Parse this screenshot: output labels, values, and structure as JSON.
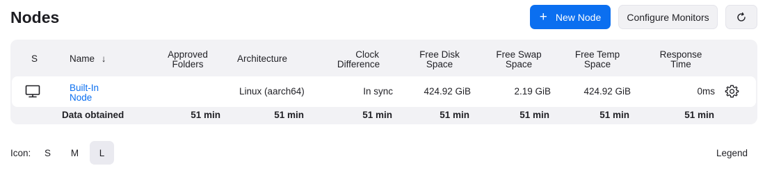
{
  "header": {
    "title": "Nodes",
    "new_node_label": "New Node",
    "configure_monitors_label": "Configure Monitors"
  },
  "table": {
    "columns": {
      "s": "S",
      "name": "Name",
      "name_sort": "↓",
      "approved_folders_1": "Approved",
      "approved_folders_2": "Folders",
      "architecture": "Architecture",
      "clock_1": "Clock",
      "clock_2": "Difference",
      "disk_1": "Free Disk",
      "disk_2": "Space",
      "swap_1": "Free Swap",
      "swap_2": "Space",
      "temp_1": "Free Temp",
      "temp_2": "Space",
      "response_1": "Response",
      "response_2": "Time"
    },
    "rows": [
      {
        "name_1": "Built-In",
        "name_2": "Node",
        "approved_folders": "",
        "architecture": "Linux (aarch64)",
        "clock_difference": "In sync",
        "free_disk_space": "424.92 GiB",
        "free_swap_space": "2.19 GiB",
        "free_temp_space": "424.92 GiB",
        "response_time": "0ms"
      }
    ],
    "footer": {
      "label": "Data obtained",
      "approved_folders": "51 min",
      "architecture": "51 min",
      "clock_difference": "51 min",
      "free_disk_space": "51 min",
      "free_swap_space": "51 min",
      "free_temp_space": "51 min",
      "response_time": "51 min"
    }
  },
  "icon_size": {
    "label": "Icon:",
    "options": [
      "S",
      "M",
      "L"
    ],
    "selected": "L"
  },
  "legend_label": "Legend",
  "colors": {
    "accent": "#0b6ff0",
    "panel": "#f2f2f5"
  },
  "icons": [
    "plus-icon",
    "refresh-icon",
    "computer-icon",
    "gear-icon"
  ]
}
